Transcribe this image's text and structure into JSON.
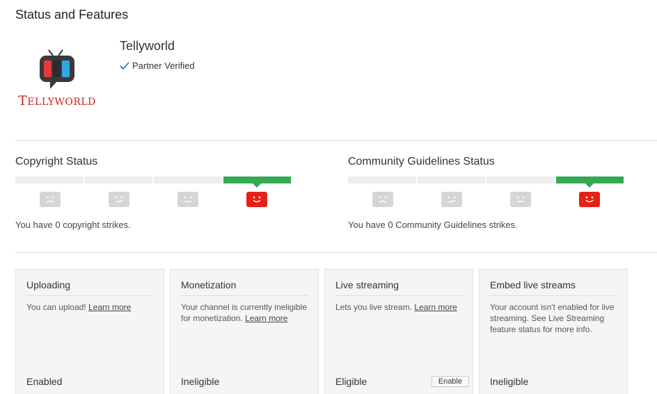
{
  "page": {
    "title": "Status and Features"
  },
  "channel": {
    "name": "Tellyworld",
    "verified_label": "Partner Verified",
    "logo_text": "Tellyworld",
    "logo_icon": "tv-icon"
  },
  "copyright": {
    "title": "Copyright Status",
    "strikes": 0,
    "max_level": 4,
    "active_level": 4,
    "text": "You have 0 copyright strikes."
  },
  "community": {
    "title": "Community Guidelines Status",
    "strikes": 0,
    "max_level": 4,
    "active_level": 4,
    "text": "You have 0 Community Guidelines strikes."
  },
  "features": [
    {
      "title": "Uploading",
      "text": "You can upload!",
      "link": "Learn more",
      "status": "Enabled"
    },
    {
      "title": "Monetization",
      "text": "Your channel is currently ineligible for monetization.",
      "link": "Learn more",
      "status": "Ineligible"
    },
    {
      "title": "Live streaming",
      "text": "Lets you live stream.",
      "link": "Learn more",
      "status": "Eligible",
      "button": "Enable"
    },
    {
      "title": "Embed live streams",
      "text": "Your account isn't enabled for live streaming. See Live Streaming feature status for more info.",
      "status": "Ineligible"
    }
  ],
  "colors": {
    "strike_ok": "#34a853",
    "face_active": "#e62117",
    "face_inactive": "#d5d5d5",
    "logo_red": "#cc2222"
  }
}
